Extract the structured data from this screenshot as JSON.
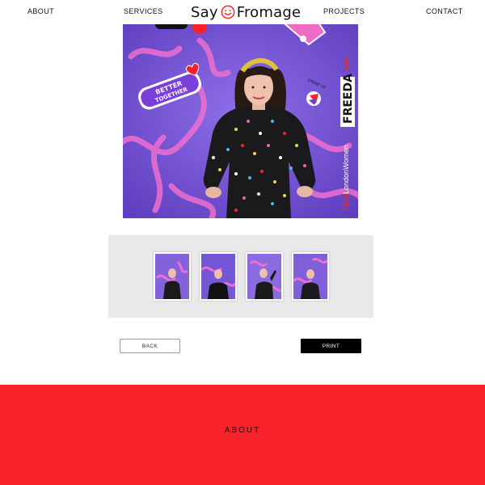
{
  "nav": {
    "about": "ABOUT",
    "services": "SERVICES",
    "projects": "PROJECTS",
    "contact": "CONTACT"
  },
  "logo": {
    "word1": "Say",
    "word2": "Fromage",
    "icon": "smiley-icon"
  },
  "photo": {
    "sticker_better": "BETTER",
    "sticker_together": "TOGETHER",
    "sticker_freeda": "FREEDA",
    "sticker_speak": "SPEAK UP",
    "backdrop_tedx": "TEDx",
    "backdrop_tedx_suffix": "LondonWomen"
  },
  "thumbnails": [
    {
      "alt": "thumbnail-1"
    },
    {
      "alt": "thumbnail-2"
    },
    {
      "alt": "thumbnail-3"
    },
    {
      "alt": "thumbnail-4"
    }
  ],
  "buttons": {
    "back": "BACK",
    "print": "PRINT"
  },
  "footer": {
    "title": "ABOUT"
  },
  "colors": {
    "footer_bg": "#f8232a",
    "backdrop": "#7b5ad6",
    "accent_pink": "#f06ac8"
  }
}
